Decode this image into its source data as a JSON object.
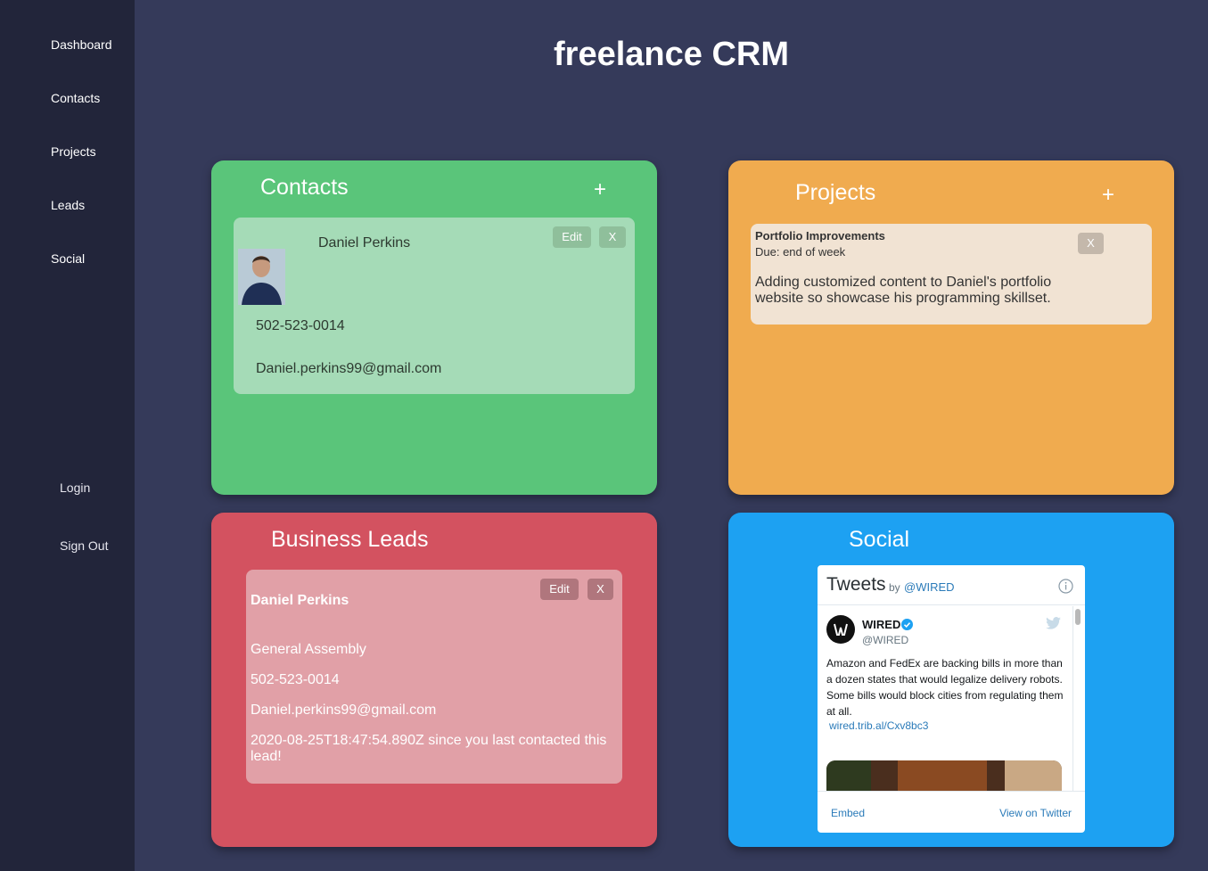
{
  "app": {
    "title": "freelance CRM"
  },
  "sidebar": {
    "items": [
      {
        "label": "Dashboard"
      },
      {
        "label": "Contacts"
      },
      {
        "label": "Projects"
      },
      {
        "label": "Leads"
      },
      {
        "label": "Social"
      }
    ],
    "login": "Login",
    "signout": "Sign Out"
  },
  "colors": {
    "contacts": "#5ac57a",
    "projects": "#f0ab4f",
    "leads": "#d35260",
    "social": "#1da1f2",
    "background": "#353a5a",
    "sidebar": "#22253a"
  },
  "contacts": {
    "title": "Contacts",
    "add": "+",
    "card": {
      "name": "Daniel Perkins",
      "phone": "502-523-0014",
      "email": "Daniel.perkins99@gmail.com",
      "edit": "Edit",
      "delete": "X"
    }
  },
  "projects": {
    "title": "Projects",
    "add": "+",
    "card": {
      "name": "Portfolio Improvements",
      "due": "Due: end of week",
      "description": "Adding customized content to Daniel's portfolio website so showcase his programming skillset.",
      "delete": "X"
    }
  },
  "leads": {
    "title": "Business Leads",
    "card": {
      "name": "Daniel Perkins",
      "company": "General Assembly",
      "phone": "502-523-0014",
      "email": "Daniel.perkins99@gmail.com",
      "last_contact": "2020-08-25T18:47:54.890Z since you last contacted this lead!",
      "edit": "Edit",
      "delete": "X"
    }
  },
  "social": {
    "title": "Social",
    "widget": {
      "heading": "Tweets",
      "by": "by",
      "handle": "@WIRED",
      "tweet": {
        "author": "WIRED",
        "author_handle": "@WIRED",
        "text": "Amazon and FedEx  are backing bills in more than a dozen states that would legalize delivery robots. Some bills would block cities from regulating them at all.",
        "link": "wired.trib.al/Cxv8bc3"
      },
      "embed": "Embed",
      "view": "View on Twitter"
    }
  }
}
